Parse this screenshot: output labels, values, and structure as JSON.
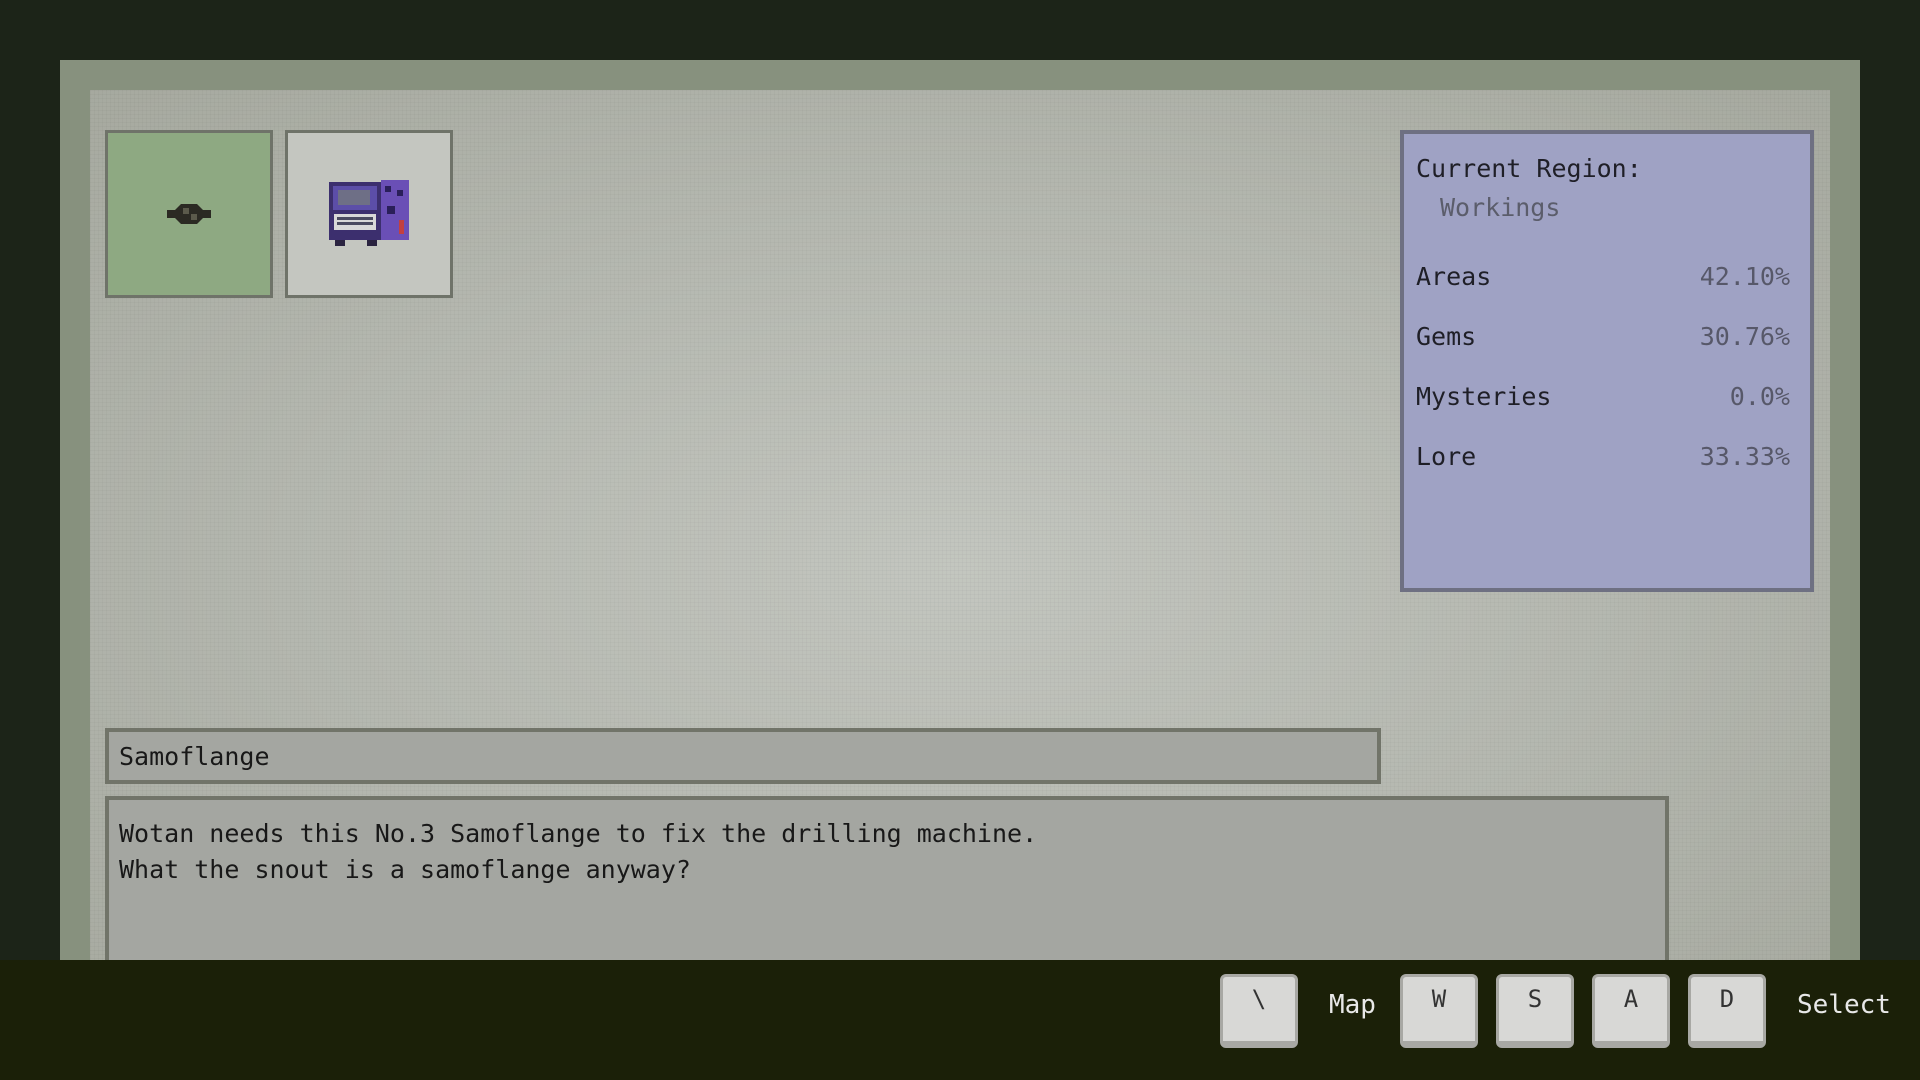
{
  "inventory": {
    "slots": [
      {
        "icon": "dark-gear-item-icon",
        "selected": true
      },
      {
        "icon": "handheld-computer-item-icon",
        "selected": false
      }
    ]
  },
  "region_panel": {
    "label": "Current Region:",
    "region": "Workings",
    "stats": [
      {
        "label": "Areas",
        "value": "42.10%"
      },
      {
        "label": "Gems",
        "value": "30.76%"
      },
      {
        "label": "Mysteries",
        "value": "0.0%"
      },
      {
        "label": "Lore",
        "value": "33.33%"
      }
    ],
    "color": "#9fa2c4"
  },
  "item": {
    "name": "Samoflange",
    "description_lines": [
      "Wotan needs this No.3 Samoflange to fix the drilling machine.",
      "What the snout is a samoflange anyway?"
    ]
  },
  "footer": {
    "map_key": "\\",
    "map_label": "Map",
    "nav_keys": [
      "W",
      "S",
      "A",
      "D"
    ],
    "select_label": "Select"
  },
  "colors": {
    "background": "#1c2418",
    "selected_slot": "#8ea982",
    "footer": "#1b2008"
  }
}
